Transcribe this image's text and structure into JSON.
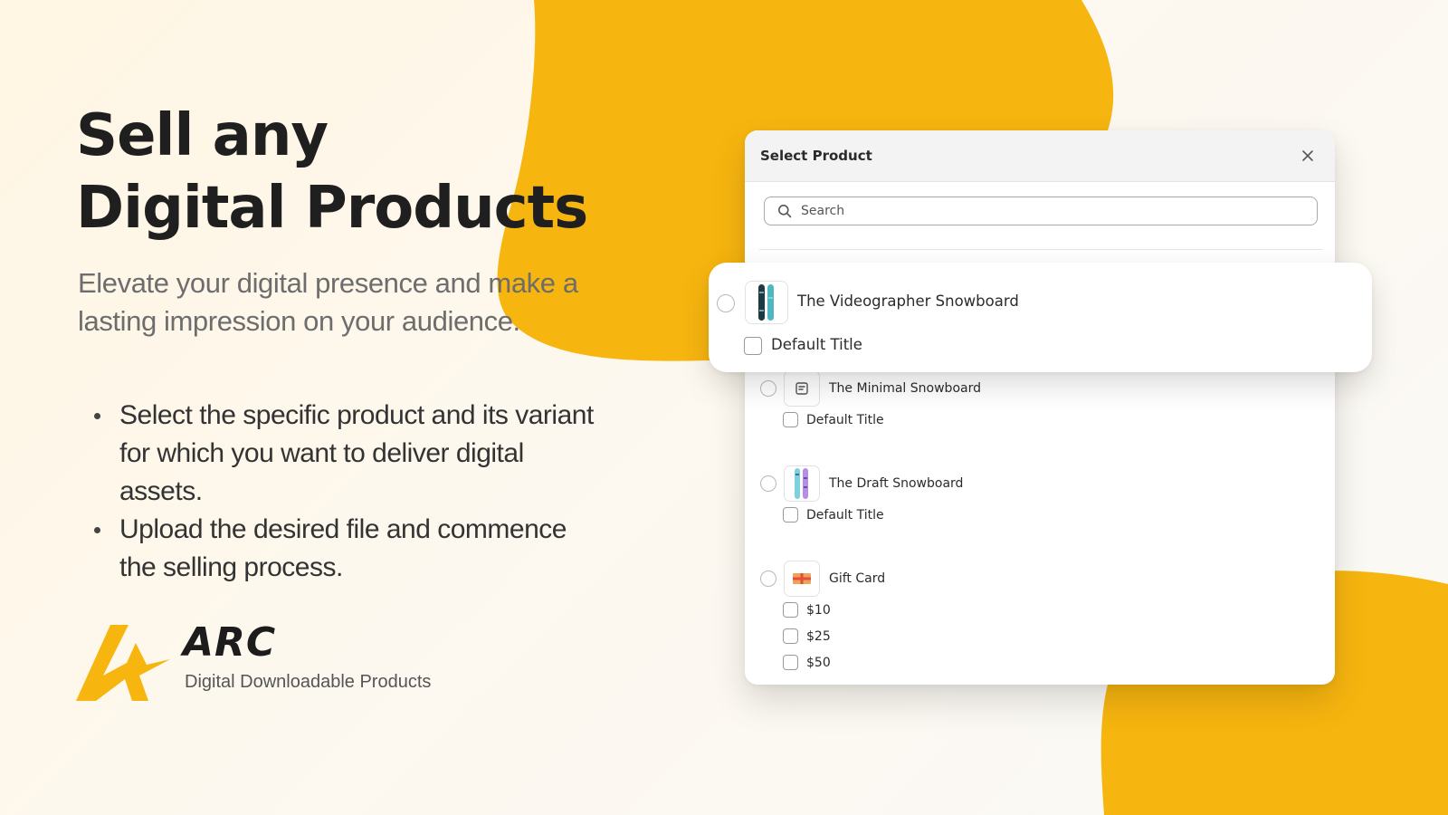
{
  "hero": {
    "title_line1": "Sell any",
    "title_line2": "Digital Products",
    "subtitle": "Elevate your digital presence and make a lasting impression on your audience.",
    "features": [
      "Select the specific product and its variant for which you want to deliver digital assets.",
      "Upload the desired file and commence the selling process."
    ]
  },
  "brand": {
    "name": "ARC",
    "tagline": "Digital Downloadable Products"
  },
  "modal": {
    "title": "Select Product",
    "search_placeholder": "Search",
    "highlighted_product": {
      "name": "The Videographer Snowboard",
      "variant": "Default Title",
      "icon": "snowboard-teal-icon"
    },
    "products": [
      {
        "name": "The Minimal Snowboard",
        "icon": "image-placeholder-icon",
        "variants": [
          "Default Title"
        ]
      },
      {
        "name": "The Draft Snowboard",
        "icon": "snowboard-purple-icon",
        "variants": [
          "Default Title"
        ]
      },
      {
        "name": "Gift Card",
        "icon": "gift-card-icon",
        "variants": [
          "$10",
          "$25",
          "$50"
        ]
      }
    ]
  },
  "colors": {
    "accent": "#f7b50f",
    "text_dark": "#1f1f1f",
    "text_muted": "#6d6d6d"
  }
}
